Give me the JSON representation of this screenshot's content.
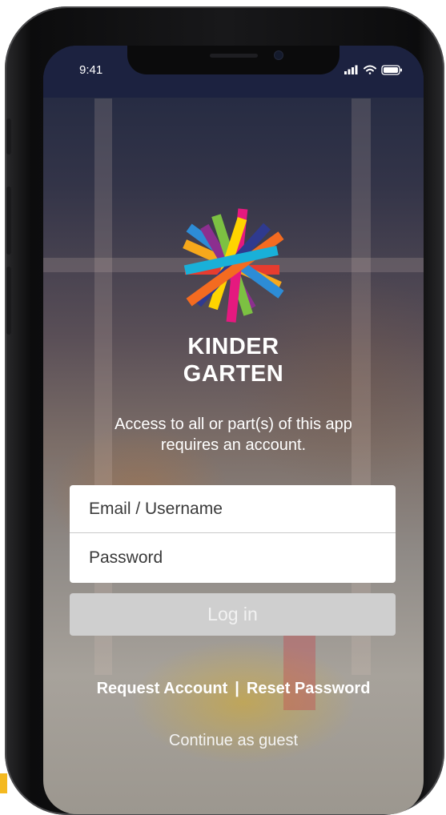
{
  "status_bar": {
    "time": "9:41",
    "icons": [
      "signal-icon",
      "wifi-icon",
      "battery-icon"
    ]
  },
  "brand": {
    "line1": "KINDER",
    "line2": "GARTEN",
    "logo_colors": [
      "#e63c2f",
      "#f7a81b",
      "#2d8cd6",
      "#8c2f8f",
      "#7cc142",
      "#e5197f",
      "#ffd400",
      "#2f3a8f",
      "#f46b20",
      "#19b0d8"
    ]
  },
  "login": {
    "notice": "Access to all or part(s) of this app requires an account.",
    "email_placeholder": "Email / Username",
    "password_placeholder": "Password",
    "login_label": "Log in"
  },
  "links": {
    "request_account": "Request Account",
    "separator": "|",
    "reset_password": "Reset Password",
    "guest": "Continue as guest"
  },
  "colors": {
    "accent_yellow": "#f4b921",
    "button_disabled": "#cfcfcf",
    "status_bar": "#1c2240"
  }
}
